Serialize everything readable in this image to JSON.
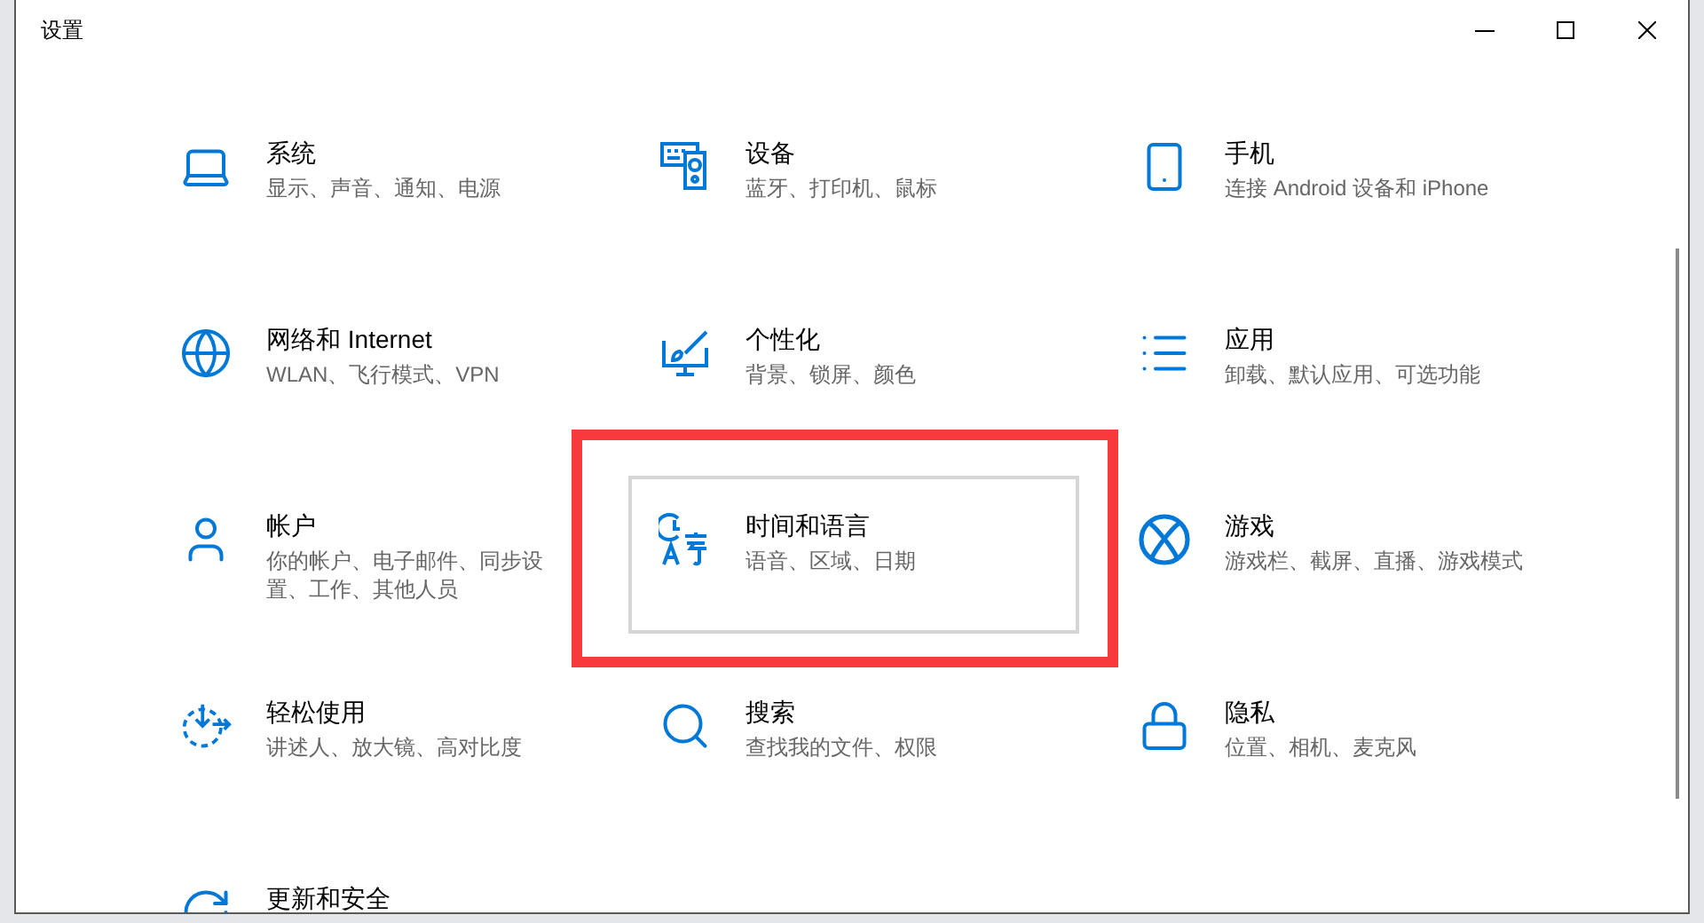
{
  "window": {
    "title": "设置"
  },
  "tiles": [
    {
      "title": "系统",
      "subtitle": "显示、声音、通知、电源",
      "selected": false,
      "annotated": false
    },
    {
      "title": "设备",
      "subtitle": "蓝牙、打印机、鼠标",
      "selected": false,
      "annotated": false
    },
    {
      "title": "手机",
      "subtitle": "连接 Android 设备和 iPhone",
      "selected": false,
      "annotated": false
    },
    {
      "title": "网络和 Internet",
      "subtitle": "WLAN、飞行模式、VPN",
      "selected": false,
      "annotated": false
    },
    {
      "title": "个性化",
      "subtitle": "背景、锁屏、颜色",
      "selected": false,
      "annotated": false
    },
    {
      "title": "应用",
      "subtitle": "卸载、默认应用、可选功能",
      "selected": false,
      "annotated": false
    },
    {
      "title": "帐户",
      "subtitle": "你的帐户、电子邮件、同步设置、工作、其他人员",
      "selected": false,
      "annotated": false
    },
    {
      "title": "时间和语言",
      "subtitle": "语音、区域、日期",
      "selected": true,
      "annotated": true
    },
    {
      "title": "游戏",
      "subtitle": "游戏栏、截屏、直播、游戏模式",
      "selected": false,
      "annotated": false
    },
    {
      "title": "轻松使用",
      "subtitle": "讲述人、放大镜、高对比度",
      "selected": false,
      "annotated": false
    },
    {
      "title": "搜索",
      "subtitle": "查找我的文件、权限",
      "selected": false,
      "annotated": false
    },
    {
      "title": "隐私",
      "subtitle": "位置、相机、麦克风",
      "selected": false,
      "annotated": false
    },
    {
      "title": "更新和安全",
      "selected": false,
      "annotated": false
    }
  ]
}
